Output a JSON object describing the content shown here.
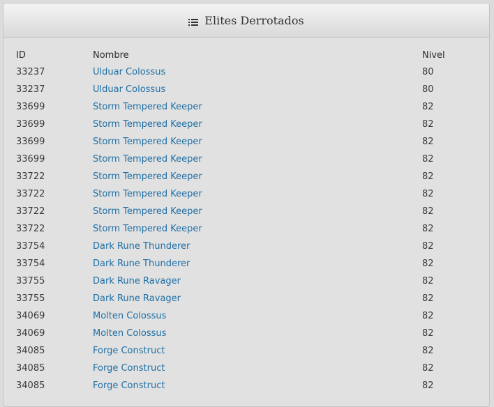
{
  "panel": {
    "title": "Elites Derrotados",
    "icon": "list-icon"
  },
  "table": {
    "headers": {
      "id": "ID",
      "name": "Nombre",
      "level": "Nivel"
    },
    "rows": [
      {
        "id": "33237",
        "name": "Ulduar Colossus",
        "level": "80"
      },
      {
        "id": "33237",
        "name": "Ulduar Colossus",
        "level": "80"
      },
      {
        "id": "33699",
        "name": "Storm Tempered Keeper",
        "level": "82"
      },
      {
        "id": "33699",
        "name": "Storm Tempered Keeper",
        "level": "82"
      },
      {
        "id": "33699",
        "name": "Storm Tempered Keeper",
        "level": "82"
      },
      {
        "id": "33699",
        "name": "Storm Tempered Keeper",
        "level": "82"
      },
      {
        "id": "33722",
        "name": "Storm Tempered Keeper",
        "level": "82"
      },
      {
        "id": "33722",
        "name": "Storm Tempered Keeper",
        "level": "82"
      },
      {
        "id": "33722",
        "name": "Storm Tempered Keeper",
        "level": "82"
      },
      {
        "id": "33722",
        "name": "Storm Tempered Keeper",
        "level": "82"
      },
      {
        "id": "33754",
        "name": "Dark Rune Thunderer",
        "level": "82"
      },
      {
        "id": "33754",
        "name": "Dark Rune Thunderer",
        "level": "82"
      },
      {
        "id": "33755",
        "name": "Dark Rune Ravager",
        "level": "82"
      },
      {
        "id": "33755",
        "name": "Dark Rune Ravager",
        "level": "82"
      },
      {
        "id": "34069",
        "name": "Molten Colossus",
        "level": "82"
      },
      {
        "id": "34069",
        "name": "Molten Colossus",
        "level": "82"
      },
      {
        "id": "34085",
        "name": "Forge Construct",
        "level": "82"
      },
      {
        "id": "34085",
        "name": "Forge Construct",
        "level": "82"
      },
      {
        "id": "34085",
        "name": "Forge Construct",
        "level": "82"
      }
    ]
  },
  "colors": {
    "link": "#1e6fa5",
    "text": "#3a3a3a",
    "background": "#e1e1e1"
  }
}
